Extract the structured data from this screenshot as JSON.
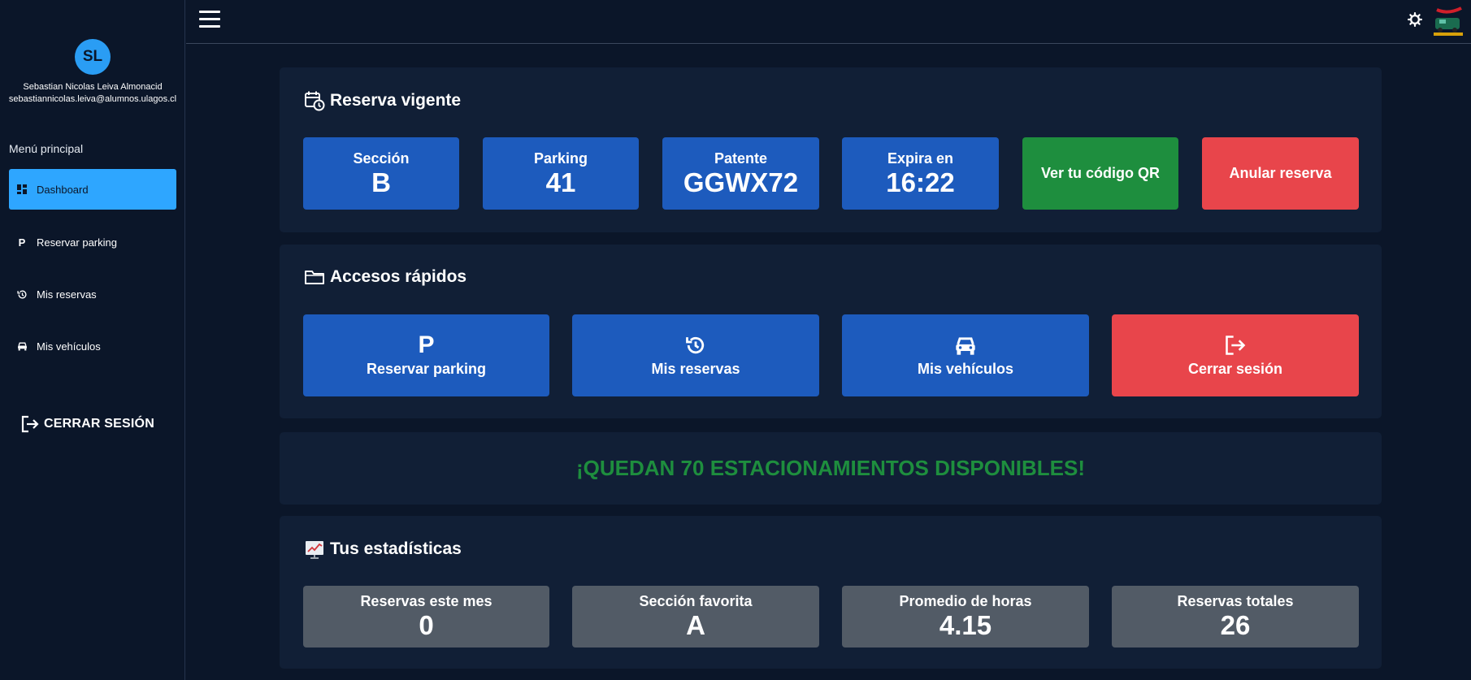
{
  "user": {
    "initials": "SL",
    "name": "Sebastian Nicolas Leiva Almonacid",
    "email": "sebastiannicolas.leiva@alumnos.ulagos.cl"
  },
  "sidebar": {
    "menu_title": "Menú principal",
    "items": [
      {
        "label": "Dashboard",
        "icon": "dashboard-icon",
        "active": true
      },
      {
        "label": "Reservar parking",
        "icon": "parking-icon"
      },
      {
        "label": "Mis reservas",
        "icon": "history-icon"
      },
      {
        "label": "Mis vehículos",
        "icon": "car-icon"
      }
    ],
    "logout_label": "CERRAR SESIÓN"
  },
  "reserva": {
    "title": "Reserva vigente",
    "seccion_label": "Sección",
    "seccion_value": "B",
    "parking_label": "Parking",
    "parking_value": "41",
    "patente_label": "Patente",
    "patente_value": "GGWX72",
    "expira_label": "Expira en",
    "expira_value": "16:22",
    "qr_button": "Ver tu código QR",
    "anular_button": "Anular reserva"
  },
  "accesos": {
    "title": "Accesos rápidos",
    "reservar_label": "Reservar parking",
    "reservas_label": "Mis reservas",
    "vehiculos_label": "Mis vehículos",
    "logout_label": "Cerrar sesión"
  },
  "availability": {
    "message": "¡QUEDAN 70 ESTACIONAMIENTOS DISPONIBLES!"
  },
  "stats": {
    "title": "Tus estadísticas",
    "items": [
      {
        "label": "Reservas este mes",
        "value": "0"
      },
      {
        "label": "Sección favorita",
        "value": "A"
      },
      {
        "label": "Promedio de horas",
        "value": "4.15"
      },
      {
        "label": "Reservas totales",
        "value": "26"
      }
    ]
  },
  "colors": {
    "background": "#0b1629",
    "panel": "#111f36",
    "accent": "#2ea6ff",
    "primary_tile": "#1d5bbd",
    "success": "#1e8e3e",
    "danger": "#e8454b",
    "stat_tile": "#525b66"
  }
}
